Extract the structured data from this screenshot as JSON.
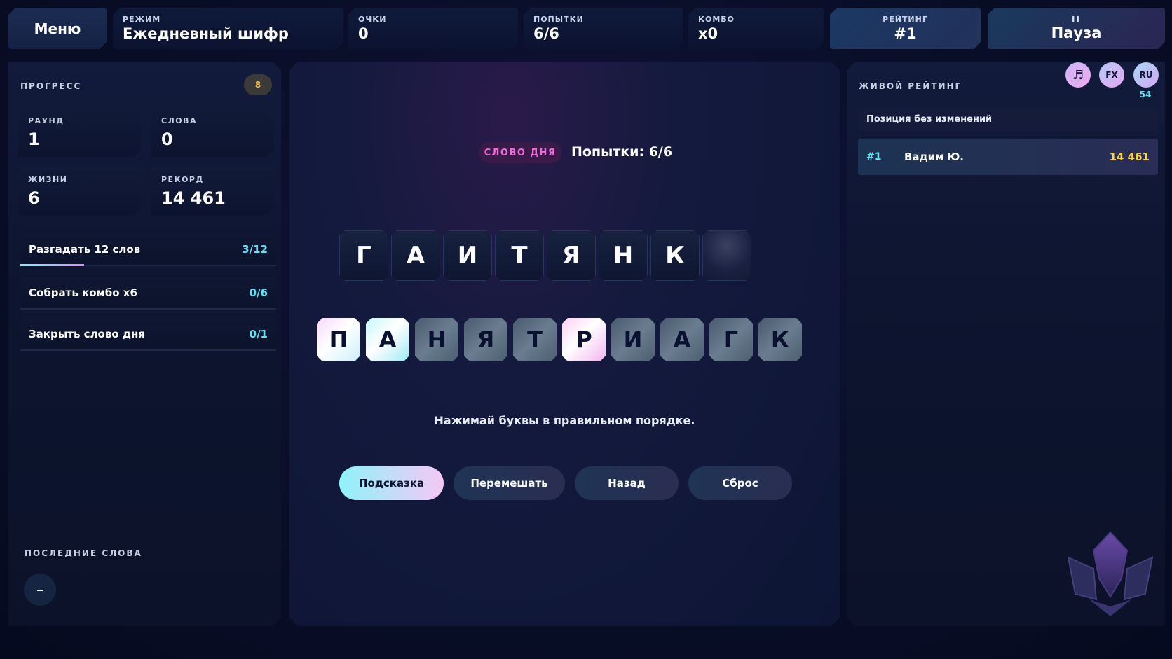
{
  "hud": {
    "menu_label": "Меню",
    "mode": {
      "label": "РЕЖИМ",
      "value": "Ежедневный шифр"
    },
    "score": {
      "label": "ОЧКИ",
      "value": "0"
    },
    "tries": {
      "label": "ПОПЫТКИ",
      "value": "6/6"
    },
    "combo": {
      "label": "КОМБО",
      "value": "x0"
    },
    "rating": {
      "label": "РЕЙТИНГ",
      "value": "#1"
    },
    "pause": {
      "icon": "II",
      "label": "Пауза"
    }
  },
  "progress": {
    "title": "ПРОГРЕСС",
    "badge": "8",
    "stats": {
      "round": {
        "label": "РАУНД",
        "value": "1"
      },
      "words": {
        "label": "СЛОВА",
        "value": "0"
      },
      "lives": {
        "label": "ЖИЗНИ",
        "value": "6"
      },
      "record": {
        "label": "РЕКОРД",
        "value": "14 461"
      }
    },
    "tasks": [
      {
        "name": "Разгадать 12 слов",
        "count": "3/12",
        "progress": 0.25
      },
      {
        "name": "Собрать комбо х6",
        "count": "0/6",
        "progress": 0
      },
      {
        "name": "Закрыть слово дня",
        "count": "0/1",
        "progress": 0
      }
    ],
    "recent_title": "ПОСЛЕДНИЕ СЛОВА",
    "recent_button": "–"
  },
  "game": {
    "daily_badge": "СЛОВО ДНЯ",
    "tries_text": "Попытки: 6/6",
    "slots": [
      "Г",
      "А",
      "И",
      "Т",
      "Я",
      "Н",
      "К",
      ""
    ],
    "tiles": [
      {
        "letter": "П",
        "style": "bright"
      },
      {
        "letter": "А",
        "style": "cyan"
      },
      {
        "letter": "Н",
        "style": "dim"
      },
      {
        "letter": "Я",
        "style": "dim"
      },
      {
        "letter": "Т",
        "style": "dim"
      },
      {
        "letter": "Р",
        "style": "pink"
      },
      {
        "letter": "И",
        "style": "dim"
      },
      {
        "letter": "А",
        "style": "dim"
      },
      {
        "letter": "Г",
        "style": "dim"
      },
      {
        "letter": "К",
        "style": "dim"
      }
    ],
    "instruction": "Нажимай буквы в правильном порядке.",
    "buttons": {
      "hint": "Подсказка",
      "shuffle": "Перемешать",
      "back": "Назад",
      "reset": "Сброс"
    }
  },
  "leaderboard": {
    "title": "ЖИВОЙ РЕЙТИНГ",
    "controls": {
      "music_icon": "♬",
      "fx": "FX",
      "lang": "RU",
      "count": "54"
    },
    "status": "Позиция без изменений",
    "rows": [
      {
        "rank": "#1",
        "name": "Вадим Ю.",
        "score": "14 461"
      }
    ]
  },
  "colors": {
    "accent_cyan": "#5fe2f2",
    "accent_pink": "#f26ad8",
    "gold": "#f6d24a",
    "background": "#0a0f2b"
  }
}
